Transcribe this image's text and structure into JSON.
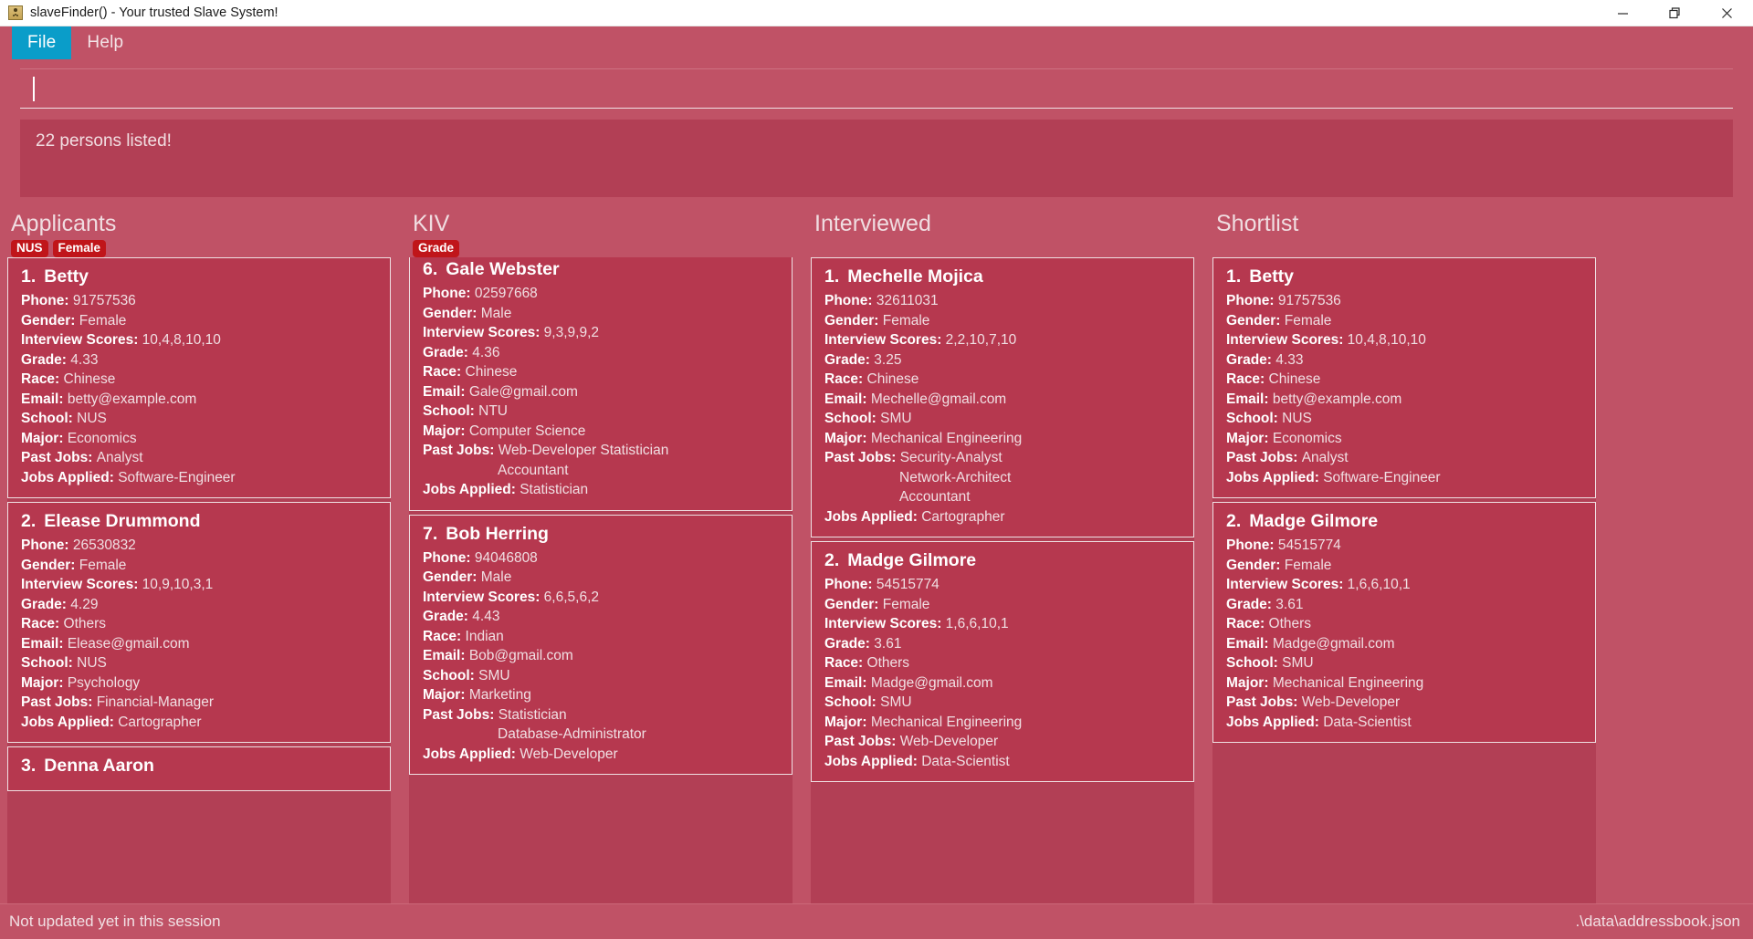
{
  "window": {
    "title": "slaveFinder() - Your trusted Slave System!",
    "icon": "person-card-icon",
    "controls": {
      "minimize": "minimize-icon",
      "maximize": "restore-icon",
      "close": "close-icon"
    }
  },
  "menubar": {
    "items": [
      {
        "label": "File",
        "active": true
      },
      {
        "label": "Help",
        "active": false
      }
    ]
  },
  "search": {
    "value": "",
    "placeholder": ""
  },
  "result_panel": {
    "text": "22 persons listed!"
  },
  "columns": [
    {
      "title": "Applicants",
      "tags": [
        "NUS",
        "Female"
      ],
      "persons": [
        {
          "index": "1.",
          "name": "Betty",
          "phone": "91757536",
          "gender": "Female",
          "interview_scores": "10,4,8,10,10",
          "grade": "4.33",
          "race": "Chinese",
          "email": "betty@example.com",
          "school": "NUS",
          "major": "Economics",
          "past_jobs": [
            "Analyst"
          ],
          "jobs_applied": [
            "Software-Engineer"
          ]
        },
        {
          "index": "2.",
          "name": "Elease Drummond",
          "phone": "26530832",
          "gender": "Female",
          "interview_scores": "10,9,10,3,1",
          "grade": "4.29",
          "race": "Others",
          "email": "Elease@gmail.com",
          "school": "NUS",
          "major": "Psychology",
          "past_jobs": [
            "Financial-Manager"
          ],
          "jobs_applied": [
            "Cartographer"
          ]
        },
        {
          "index": "3.",
          "name": "Denna Aaron",
          "phone": "",
          "gender": "",
          "interview_scores": "",
          "grade": "",
          "race": "",
          "email": "",
          "school": "",
          "major": "",
          "past_jobs": [],
          "jobs_applied": []
        }
      ]
    },
    {
      "title": "KIV",
      "tags": [
        "Grade"
      ],
      "persons": [
        {
          "index": "6.",
          "name": "Gale Webster",
          "phone": "02597668",
          "gender": "Male",
          "interview_scores": "9,3,9,9,2",
          "grade": "4.36",
          "race": "Chinese",
          "email": "Gale@gmail.com",
          "school": "NTU",
          "major": "Computer Science",
          "past_jobs": [
            "Web-Developer  Statistician",
            "Accountant"
          ],
          "jobs_applied": [
            "Statistician"
          ]
        },
        {
          "index": "7.",
          "name": "Bob Herring",
          "phone": "94046808",
          "gender": "Male",
          "interview_scores": "6,6,5,6,2",
          "grade": "4.43",
          "race": "Indian",
          "email": "Bob@gmail.com",
          "school": "SMU",
          "major": "Marketing",
          "past_jobs": [
            "Statistician",
            "Database-Administrator"
          ],
          "jobs_applied": [
            "Web-Developer"
          ]
        }
      ]
    },
    {
      "title": "Interviewed",
      "tags": [],
      "persons": [
        {
          "index": "1.",
          "name": "Mechelle Mojica",
          "phone": "32611031",
          "gender": "Female",
          "interview_scores": "2,2,10,7,10",
          "grade": "3.25",
          "race": "Chinese",
          "email": "Mechelle@gmail.com",
          "school": "SMU",
          "major": "Mechanical Engineering",
          "past_jobs": [
            "Security-Analyst",
            "Network-Architect",
            "Accountant"
          ],
          "jobs_applied": [
            "Cartographer"
          ]
        },
        {
          "index": "2.",
          "name": "Madge Gilmore",
          "phone": "54515774",
          "gender": "Female",
          "interview_scores": "1,6,6,10,1",
          "grade": "3.61",
          "race": "Others",
          "email": "Madge@gmail.com",
          "school": "SMU",
          "major": "Mechanical Engineering",
          "past_jobs": [
            "Web-Developer"
          ],
          "jobs_applied": [
            "Data-Scientist"
          ]
        }
      ]
    },
    {
      "title": "Shortlist",
      "tags": [],
      "persons": [
        {
          "index": "1.",
          "name": "Betty",
          "phone": "91757536",
          "gender": "Female",
          "interview_scores": "10,4,8,10,10",
          "grade": "4.33",
          "race": "Chinese",
          "email": "betty@example.com",
          "school": "NUS",
          "major": "Economics",
          "past_jobs": [
            "Analyst"
          ],
          "jobs_applied": [
            "Software-Engineer"
          ]
        },
        {
          "index": "2.",
          "name": "Madge Gilmore",
          "phone": "54515774",
          "gender": "Female",
          "interview_scores": "1,6,6,10,1",
          "grade": "3.61",
          "race": "Others",
          "email": "Madge@gmail.com",
          "school": "SMU",
          "major": "Mechanical Engineering",
          "past_jobs": [
            "Web-Developer"
          ],
          "jobs_applied": [
            "Data-Scientist"
          ]
        }
      ]
    }
  ],
  "field_labels": {
    "phone": "Phone:",
    "gender": "Gender:",
    "interview_scores": "Interview Scores:",
    "grade": "Grade:",
    "race": "Race:",
    "email": "Email:",
    "school": "School:",
    "major": "Major:",
    "past_jobs": "Past Jobs:",
    "jobs_applied": "Jobs Applied:"
  },
  "statusbar": {
    "left": "Not updated yet in this session",
    "right": ".\\data\\addressbook.json"
  },
  "colors": {
    "background": "#c05266",
    "panel": "#b23f55",
    "card": "#b6384f",
    "accent": "#0a9dc9",
    "tag": "#c0151a",
    "text": "#f3e5e8"
  }
}
